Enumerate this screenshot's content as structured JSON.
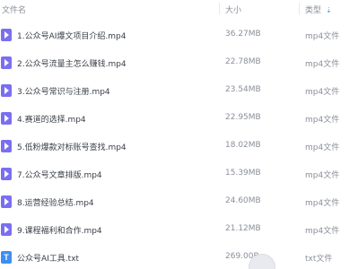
{
  "header": {
    "name_label": "文件名",
    "size_label": "大小",
    "type_label": "类型"
  },
  "files": [
    {
      "name": "1.公众号AI爆文项目介绍.mp4",
      "size": "36.27MB",
      "type": "mp4文件",
      "icon": "video-file-icon"
    },
    {
      "name": "2.公众号流量主怎么赚钱.mp4",
      "size": "22.78MB",
      "type": "mp4文件",
      "icon": "video-file-icon"
    },
    {
      "name": "3.公众号常识与注册.mp4",
      "size": "23.54MB",
      "type": "mp4文件",
      "icon": "video-file-icon"
    },
    {
      "name": "4.赛道的选择.mp4",
      "size": "22.95MB",
      "type": "mp4文件",
      "icon": "video-file-icon"
    },
    {
      "name": "5.低粉爆款对标账号查找.mp4",
      "size": "18.02MB",
      "type": "mp4文件",
      "icon": "video-file-icon"
    },
    {
      "name": "7.公众号文章排版.mp4",
      "size": "15.39MB",
      "type": "mp4文件",
      "icon": "video-file-icon"
    },
    {
      "name": "8.运营经验总结.mp4",
      "size": "24.60MB",
      "type": "mp4文件",
      "icon": "video-file-icon"
    },
    {
      "name": "9.课程福利和合作.mp4",
      "size": "21.12MB",
      "type": "mp4文件",
      "icon": "video-file-icon"
    },
    {
      "name": "公众号AI工具.txt",
      "size": "269.00B",
      "type": "txt文件",
      "icon": "text-file-icon"
    }
  ]
}
